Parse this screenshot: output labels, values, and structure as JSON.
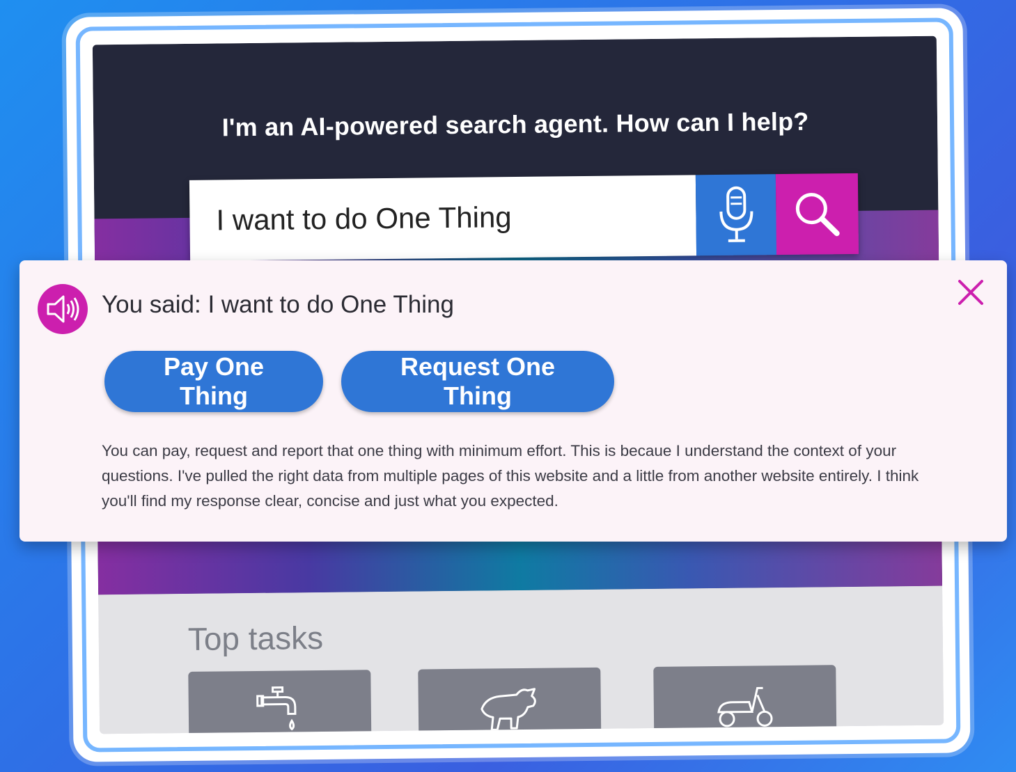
{
  "hero": {
    "title": "I'm an AI-powered search agent. How can I help?"
  },
  "search": {
    "value": "I want to do One Thing",
    "mic_icon": "microphone-icon",
    "search_icon": "search-icon",
    "mic_color": "#2f76d6",
    "search_color": "#cc1fae"
  },
  "response": {
    "you_said": "You said: I want to do One Thing",
    "speaker_icon": "speaker-icon",
    "close_icon": "close-icon",
    "suggestions": [
      {
        "label": "Pay One Thing"
      },
      {
        "label": "Request One Thing"
      }
    ],
    "answer": "You can pay, request and report that one thing with minimum effort. This is becaue I understand the context of your questions. I've pulled the right data from multiple pages of this website and a little from another website entirely. I think you'll find my response clear, concise and  just what you expected."
  },
  "tasks": {
    "title": "Top tasks",
    "tiles": [
      {
        "icon": "tap-icon"
      },
      {
        "icon": "dog-icon"
      },
      {
        "icon": "scooter-icon"
      }
    ]
  },
  "colors": {
    "accent_blue": "#2f76d6",
    "accent_magenta": "#cc1fae",
    "hero_dark": "#24273a",
    "panel_bg": "#fcf3f8"
  }
}
